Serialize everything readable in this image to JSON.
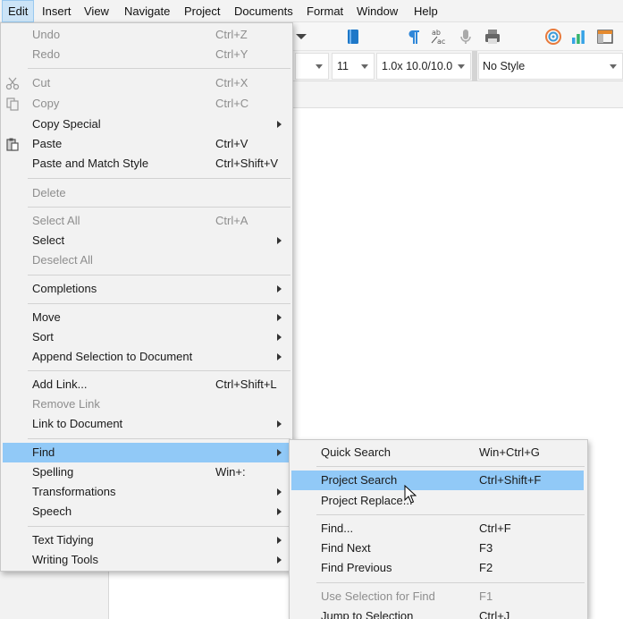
{
  "menubar": {
    "items": [
      {
        "label": "Edit",
        "active": true
      },
      {
        "label": "Insert"
      },
      {
        "label": "View"
      },
      {
        "label": "Navigate"
      },
      {
        "label": "Project"
      },
      {
        "label": "Documents"
      },
      {
        "label": "Format"
      },
      {
        "label": "Window"
      },
      {
        "label": "Help"
      }
    ]
  },
  "toolbar": {
    "icons": [
      "dropdown-arrow-icon",
      "composition-book-icon",
      "pilcrow-icon",
      "spellcheck-ab-ac-icon",
      "microphone-icon",
      "printer-icon",
      "target-icon",
      "bar-chart-icon",
      "layout-icon"
    ]
  },
  "format_bar": {
    "font_size": "11",
    "line_spacing": "1.0x 10.0/10.0",
    "style": "No Style"
  },
  "edit_menu": {
    "items": [
      {
        "label": "Undo",
        "shortcut": "Ctrl+Z",
        "disabled": true
      },
      {
        "label": "Redo",
        "shortcut": "Ctrl+Y",
        "disabled": true
      },
      {
        "label": "Cut",
        "shortcut": "Ctrl+X",
        "disabled": true,
        "icon": "scissors-icon"
      },
      {
        "label": "Copy",
        "shortcut": "Ctrl+C",
        "disabled": true,
        "icon": "copy-icon"
      },
      {
        "label": "Copy Special",
        "submenu": true
      },
      {
        "label": "Paste",
        "shortcut": "Ctrl+V",
        "icon": "paste-icon"
      },
      {
        "label": "Paste and Match Style",
        "shortcut": "Ctrl+Shift+V"
      },
      {
        "label": "Delete",
        "disabled": true
      },
      {
        "label": "Select All",
        "shortcut": "Ctrl+A",
        "disabled": true
      },
      {
        "label": "Select",
        "submenu": true
      },
      {
        "label": "Deselect All",
        "disabled": true
      },
      {
        "label": "Completions",
        "submenu": true
      },
      {
        "label": "Move",
        "submenu": true
      },
      {
        "label": "Sort",
        "submenu": true
      },
      {
        "label": "Append Selection to Document",
        "submenu": true
      },
      {
        "label": "Add Link...",
        "shortcut": "Ctrl+Shift+L"
      },
      {
        "label": "Remove Link",
        "disabled": true
      },
      {
        "label": "Link to Document",
        "submenu": true
      },
      {
        "label": "Find",
        "submenu": true,
        "highlight": true
      },
      {
        "label": "Spelling",
        "shortcut": "Win+:"
      },
      {
        "label": "Transformations",
        "submenu": true
      },
      {
        "label": "Speech",
        "submenu": true
      },
      {
        "label": "Text Tidying",
        "submenu": true
      },
      {
        "label": "Writing Tools",
        "submenu": true
      }
    ]
  },
  "find_submenu": {
    "items": [
      {
        "label": "Quick Search",
        "shortcut": "Win+Ctrl+G"
      },
      {
        "label": "Project Search",
        "shortcut": "Ctrl+Shift+F",
        "highlight": true
      },
      {
        "label": "Project Replace..."
      },
      {
        "label": "Find...",
        "shortcut": "Ctrl+F"
      },
      {
        "label": "Find Next",
        "shortcut": "F3"
      },
      {
        "label": "Find Previous",
        "shortcut": "F2"
      },
      {
        "label": "Use Selection for Find",
        "shortcut": "F1",
        "disabled": true
      },
      {
        "label": "Jump to Selection",
        "shortcut": "Ctrl+J"
      }
    ]
  },
  "colors": {
    "menu_bg": "#f2f2f2",
    "highlight": "#91c9f7",
    "menubar_active": "#cce4f7",
    "disabled_text": "#8e8e8e"
  }
}
